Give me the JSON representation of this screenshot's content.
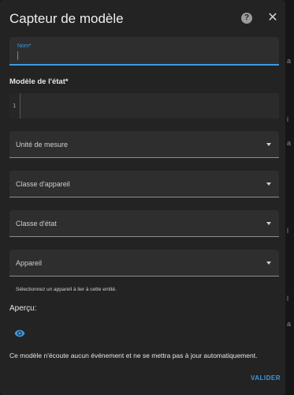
{
  "dialog": {
    "title": "Capteur de modèle",
    "help_icon": "help-icon",
    "close_icon": "close-icon"
  },
  "fields": {
    "name_label": "Nom*",
    "template_label": "Modèle de l'état*",
    "line_number": "1",
    "unit_label": "Unité de mesure",
    "device_class_label": "Classe d'appareil",
    "state_class_label": "Classe d'état",
    "device_label": "Appareil",
    "device_helper": "Sélectionnez un appareil à lier à cette entité."
  },
  "preview": {
    "label": "Aperçu:",
    "icon": "eye-icon",
    "message": "Ce modèle n'écoute aucun événement et ne se mettra pas à jour automatiquement."
  },
  "actions": {
    "submit_label": "VALIDER"
  },
  "background": {
    "items": [
      "a",
      "i",
      "a",
      "l",
      "l",
      "a"
    ]
  },
  "colors": {
    "accent": "#3a9ae2",
    "dialog_bg": "#232323",
    "field_bg": "#2e2e2e"
  }
}
